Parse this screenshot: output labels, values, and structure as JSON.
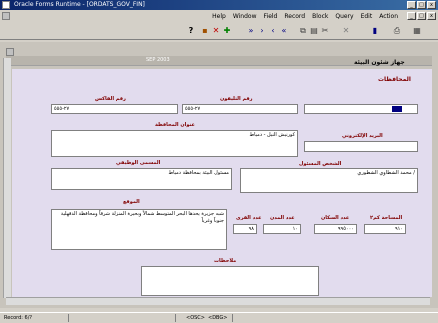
{
  "window": {
    "title": "Oracle Forms Runtime - [ORDATS_GOV_FIN]"
  },
  "menu": {
    "items": [
      "Help",
      "Window",
      "Field",
      "Record",
      "Block",
      "Query",
      "Edit",
      "Action"
    ]
  },
  "toolbar": {
    "icons": [
      "help-icon",
      "exit-icon",
      "delete-record-icon",
      "insert-record-icon",
      "last-record-icon",
      "next-record-icon",
      "previous-record-icon",
      "first-record-icon",
      "copy-icon",
      "paste-icon",
      "cut-icon",
      "clear-icon",
      "save-icon",
      "print-icon",
      "enter-query-icon"
    ]
  },
  "subwindow": {
    "title": "SEP 2003"
  },
  "form": {
    "header_title": "جهاز شئون البيئة",
    "block_title": "المحافظات",
    "fields": {
      "fax_label": "رقم الفاكس",
      "fax_value": "٢٧-٥٥٥",
      "phone_label": "رقم التليفون",
      "phone_value": "٢٧-٥٥٥",
      "name_value": "",
      "address_label": "عنوان المحافظة",
      "address_value": "كورنيش النيل - دمياط",
      "email_label": "البريد الإلكتروني",
      "email_value": "",
      "title_label": "المسمى الوظيفي",
      "title_value": "مسئول البيئة بمحافظة دمياط",
      "person_label": "الشخص المسئول",
      "person_value": "/ محمد الشطاوي الشطوري",
      "location_label": "الموقع",
      "location_value": "شبه جزيرة يحدها البحر المتوسط شمالاً وبحيرة المنزلة شرقاً ومحافظة الدقهلية جنوباً وغرباً",
      "villages_label": "عدد القرى",
      "villages_value": "٩٨",
      "cities_label": "عدد المدن",
      "cities_value": "١٠",
      "population_label": "عدد السكان",
      "population_value": "٩٩٥٠٠٠",
      "area_label": "المساحة كم٢",
      "area_value": "٩١٠",
      "notes_label": "ملاحظات",
      "notes_value": ""
    }
  },
  "status": {
    "record": "Record: 6/?",
    "osc": "<OSC>",
    "dbg": "<DBG>"
  }
}
